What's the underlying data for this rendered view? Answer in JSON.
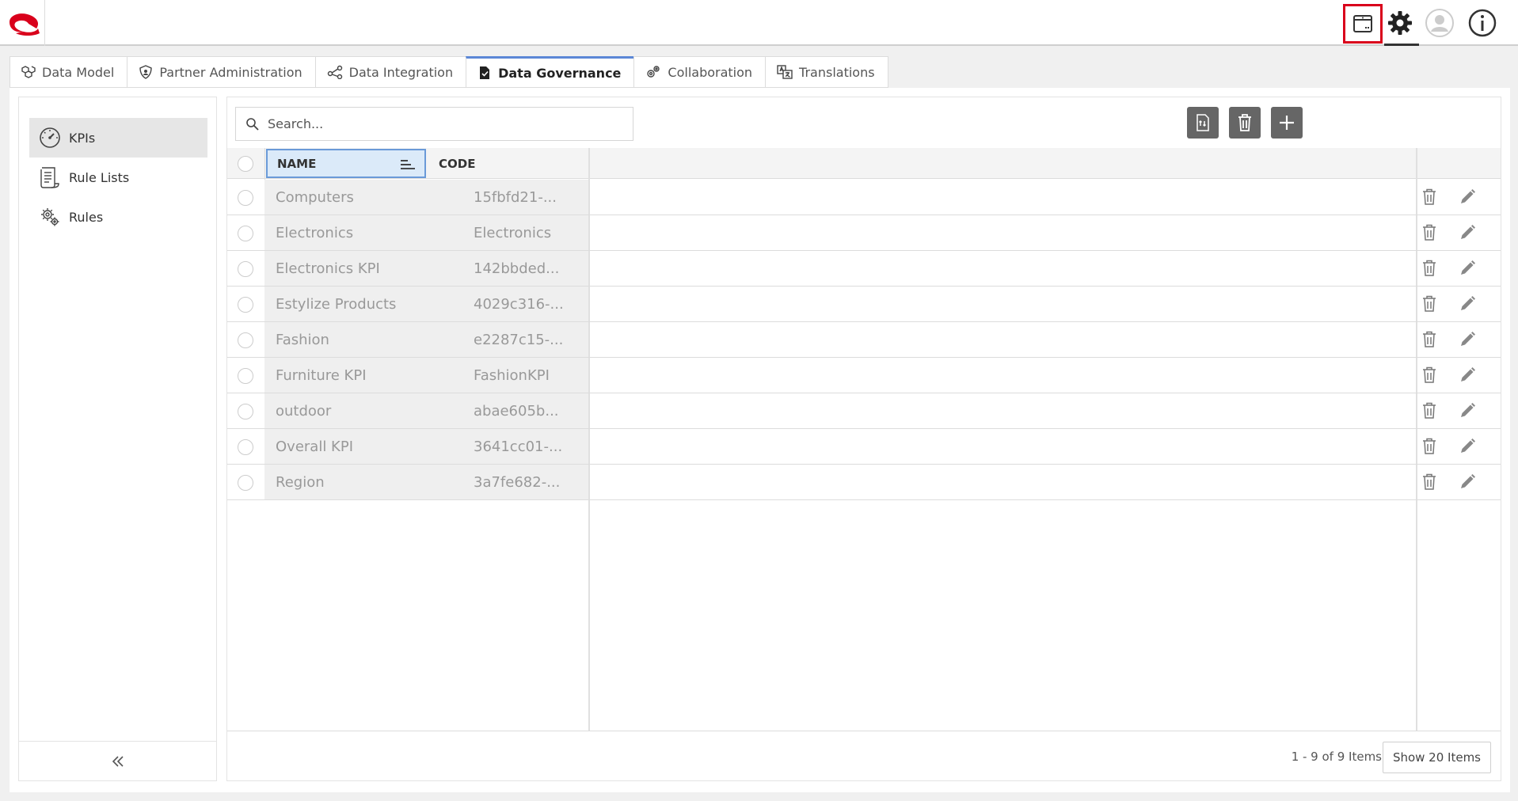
{
  "tabs": [
    {
      "label": "Data Model",
      "icon": "cubes-icon"
    },
    {
      "label": "Partner Administration",
      "icon": "shield-icon"
    },
    {
      "label": "Data Integration",
      "icon": "nodes-icon"
    },
    {
      "label": "Data Governance",
      "icon": "document-check-icon",
      "active": true
    },
    {
      "label": "Collaboration",
      "icon": "gears-icon"
    },
    {
      "label": "Translations",
      "icon": "translate-icon"
    }
  ],
  "sidebar": {
    "items": [
      {
        "label": "KPIs",
        "icon": "gauge-icon",
        "active": true
      },
      {
        "label": "Rule Lists",
        "icon": "list-document-icon"
      },
      {
        "label": "Rules",
        "icon": "gear-cycle-icon"
      }
    ]
  },
  "search": {
    "placeholder": "Search..."
  },
  "grid": {
    "headers": {
      "name": "NAME",
      "code": "CODE"
    },
    "rows": [
      {
        "name": "Computers",
        "code": "15fbfd21-..."
      },
      {
        "name": "Electronics",
        "code": "Electronics"
      },
      {
        "name": "Electronics KPI",
        "code": "142bbded..."
      },
      {
        "name": "Estylize Products",
        "code": "4029c316-..."
      },
      {
        "name": "Fashion",
        "code": "e2287c15-..."
      },
      {
        "name": "Furniture KPI",
        "code": "FashionKPI"
      },
      {
        "name": "outdoor",
        "code": "abae605b..."
      },
      {
        "name": "Overall KPI",
        "code": "3641cc01-..."
      },
      {
        "name": "Region",
        "code": "3a7fe682-..."
      }
    ]
  },
  "footer": {
    "pager_info": "1 - 9 of 9 Items",
    "show_button": "Show 20 Items"
  },
  "colors": {
    "brand": "#d9001b",
    "active_tab": "#5b87d6",
    "selected_header": "#dbeaf9",
    "toolbar_button": "#666666"
  }
}
